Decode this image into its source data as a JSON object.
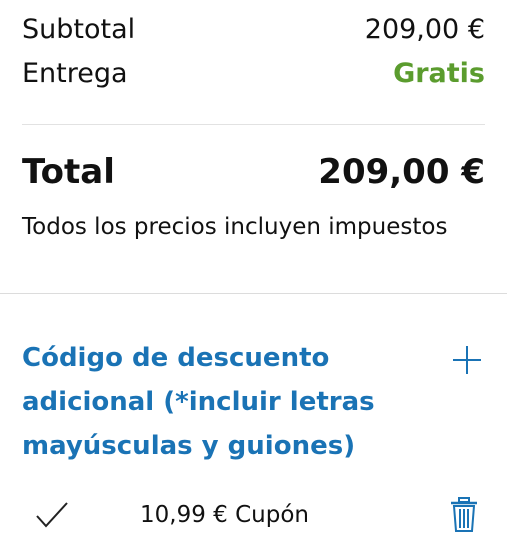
{
  "summary": {
    "subtotal_label": "Subtotal",
    "subtotal_value": "209,00 €",
    "delivery_label": "Entrega",
    "delivery_value": "Gratis",
    "total_label": "Total",
    "total_value": "209,00 €",
    "tax_note": "Todos los precios incluyen impuestos"
  },
  "discount": {
    "title": "Código de descuento adicional (*incluir letras mayúsculas y guiones)",
    "expand_icon": "plus-icon"
  },
  "coupon": {
    "status_icon": "check-icon",
    "text": "10,99 € Cupón",
    "remove_icon": "trash-icon"
  },
  "colors": {
    "free_green": "#5b9c2e",
    "link_blue": "#1a73b5",
    "divider": "#e2e2e2"
  }
}
